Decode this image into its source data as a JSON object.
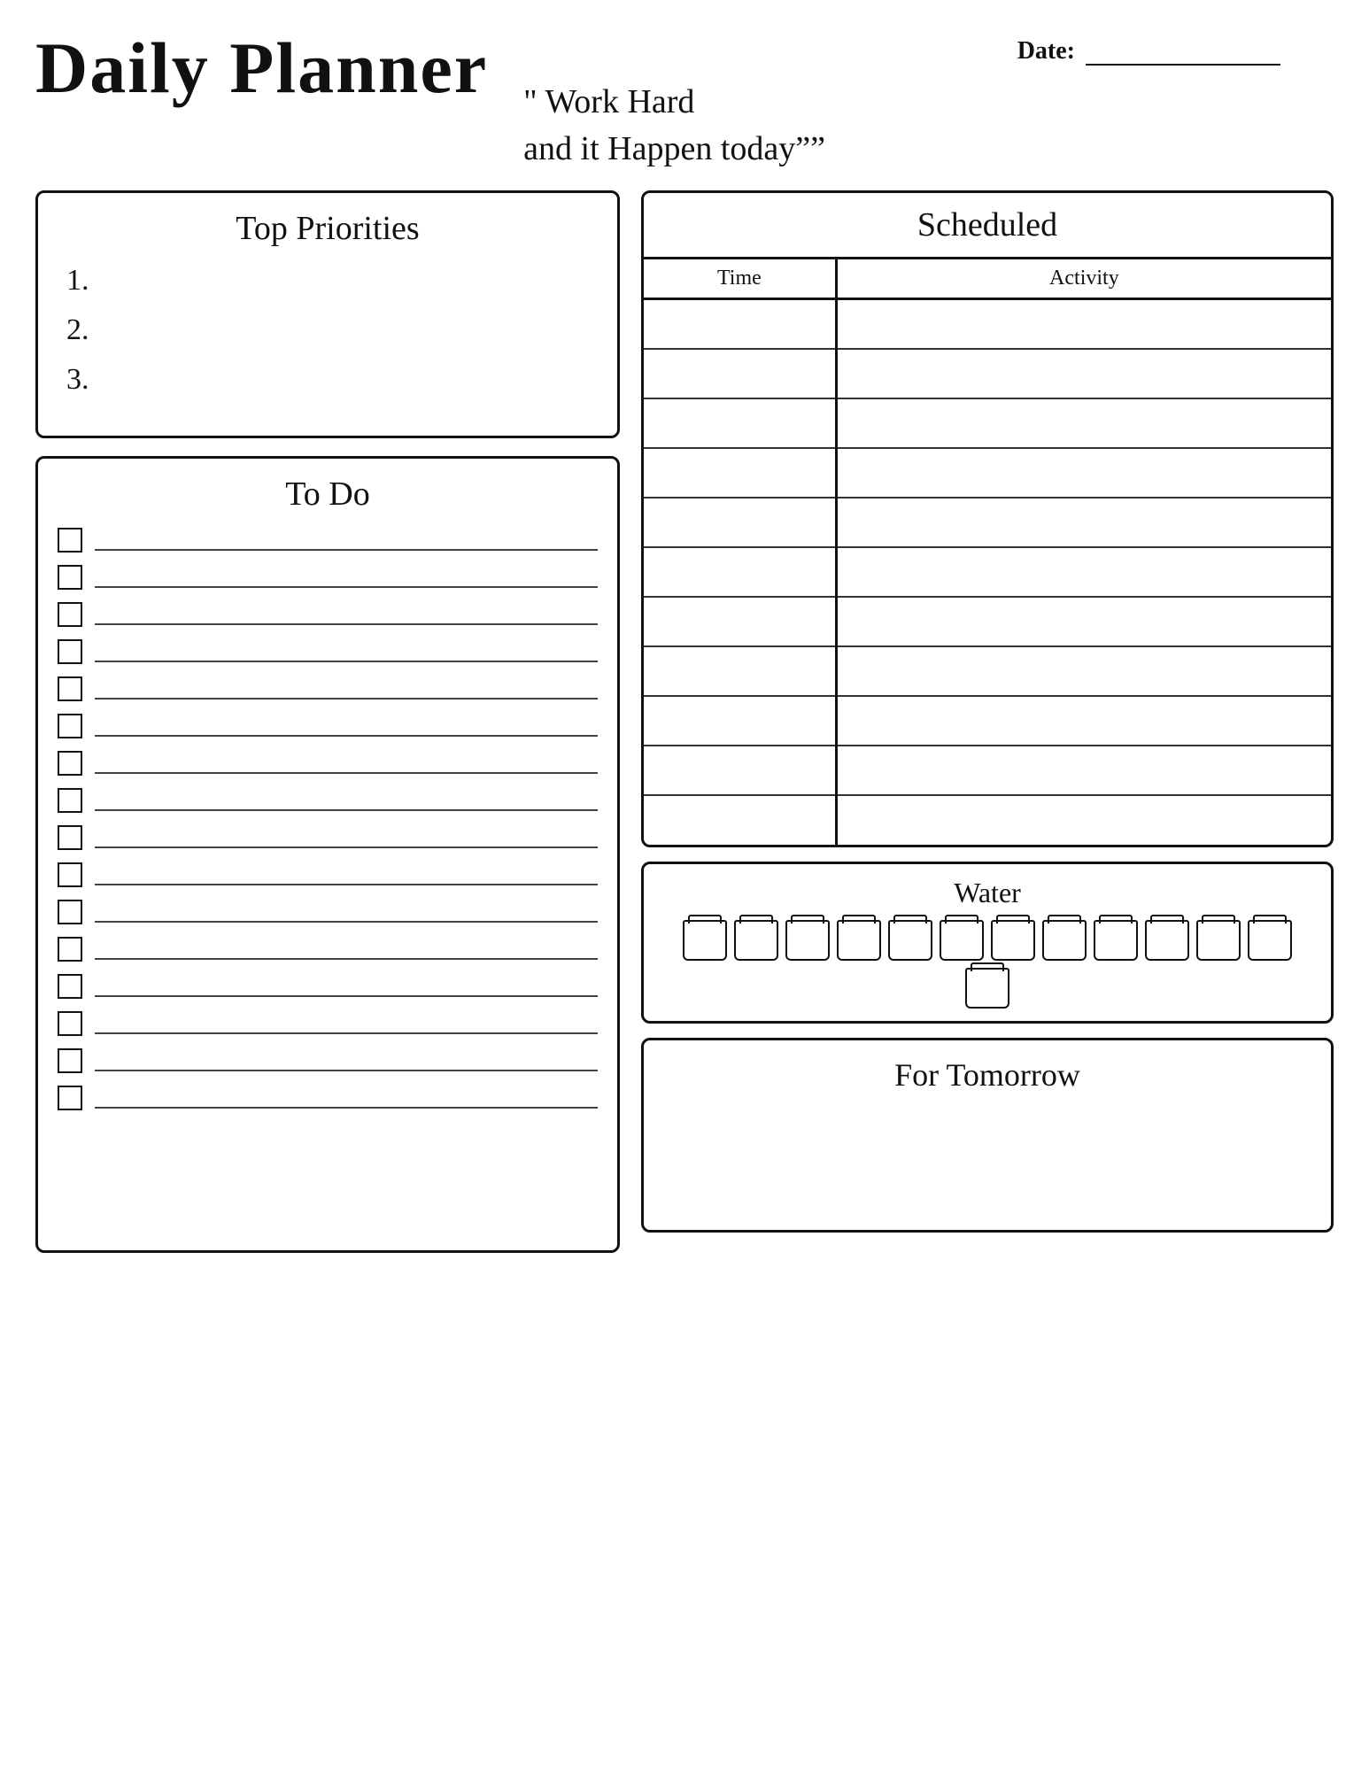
{
  "header": {
    "title": "Daily Planner",
    "date_label": "Date:",
    "quote_line1": "\" Work Hard",
    "quote_line2": "and it Happen today””"
  },
  "priorities": {
    "title": "Top Priorities",
    "items": [
      "1.",
      "2.",
      "3."
    ]
  },
  "todo": {
    "title": "To Do",
    "count": 16
  },
  "scheduled": {
    "title": "Scheduled",
    "col_time": "Time",
    "col_activity": "Activity",
    "rows": 11
  },
  "water": {
    "title": "Water",
    "cups": 13
  },
  "tomorrow": {
    "title": "For Tomorrow"
  }
}
